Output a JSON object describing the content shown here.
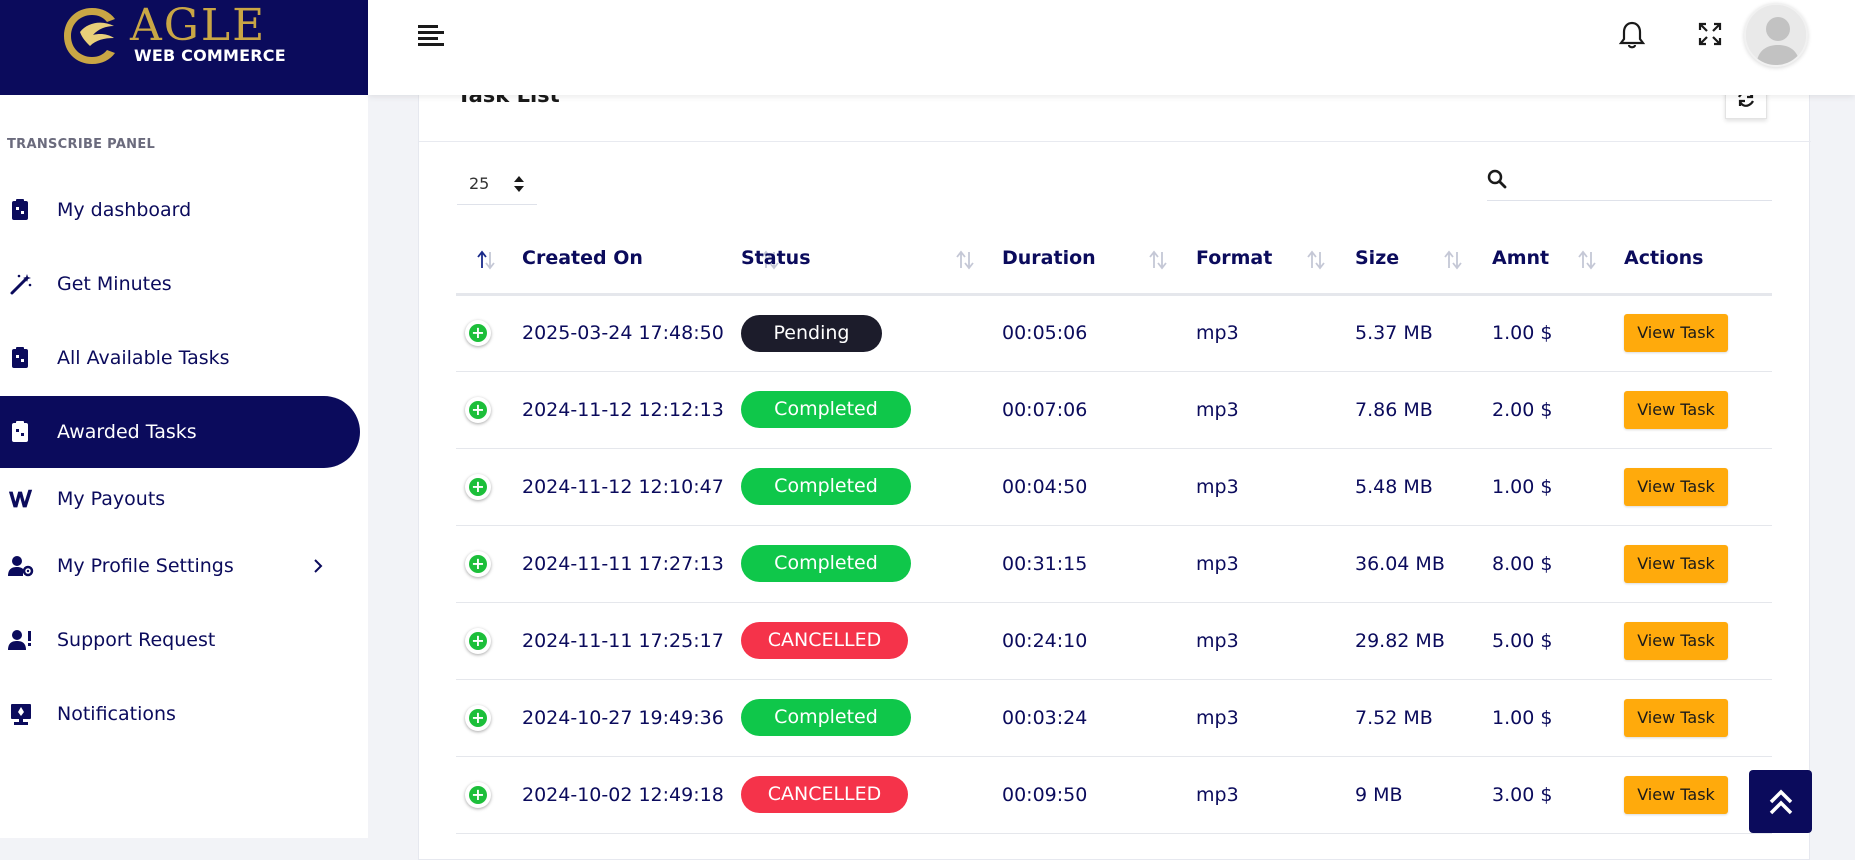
{
  "brand": {
    "logo_word": "AGLE",
    "logo_subtitle": "WEB COMMERCE",
    "primary_color": "#0b0b5c",
    "accent_gold": "#c9a645"
  },
  "sidebar": {
    "panel_label": "TRANSCRIBE PANEL",
    "items": [
      {
        "label": "My dashboard",
        "icon": "dashboard-icon",
        "active": false
      },
      {
        "label": "Get Minutes",
        "icon": "magic-wand-icon",
        "active": false
      },
      {
        "label": "All Available Tasks",
        "icon": "tasks-icon",
        "active": false
      },
      {
        "label": "Awarded Tasks",
        "icon": "awarded-icon",
        "active": true
      },
      {
        "label": "My Payouts",
        "icon": "payouts-icon",
        "active": false
      },
      {
        "label": "My Profile Settings",
        "icon": "user-settings-icon",
        "active": false,
        "has_submenu": true
      },
      {
        "label": "Support Request",
        "icon": "support-icon",
        "active": false
      },
      {
        "label": "Notifications",
        "icon": "notifications-icon",
        "active": false
      }
    ]
  },
  "topbar": {
    "icons": [
      "menu-icon",
      "bell-icon",
      "fullscreen-icon",
      "avatar"
    ]
  },
  "card": {
    "title": "Task List",
    "page_size": "25",
    "search_placeholder": ""
  },
  "table": {
    "columns": [
      "",
      "Created On",
      "Status",
      "Duration",
      "Format",
      "Size",
      "Amnt",
      "Actions"
    ],
    "rows": [
      {
        "created_on": "2025-03-24 17:48:50",
        "status": "Pending",
        "status_type": "pending",
        "duration": "00:05:06",
        "format": "mp3",
        "size": "5.37 MB",
        "amount": "1.00 $",
        "action": "View Task"
      },
      {
        "created_on": "2024-11-12 12:12:13",
        "status": "Completed",
        "status_type": "completed",
        "duration": "00:07:06",
        "format": "mp3",
        "size": "7.86 MB",
        "amount": "2.00 $",
        "action": "View Task"
      },
      {
        "created_on": "2024-11-12 12:10:47",
        "status": "Completed",
        "status_type": "completed",
        "duration": "00:04:50",
        "format": "mp3",
        "size": "5.48 MB",
        "amount": "1.00 $",
        "action": "View Task"
      },
      {
        "created_on": "2024-11-11 17:27:13",
        "status": "Completed",
        "status_type": "completed",
        "duration": "00:31:15",
        "format": "mp3",
        "size": "36.04 MB",
        "amount": "8.00 $",
        "action": "View Task"
      },
      {
        "created_on": "2024-11-11 17:25:17",
        "status": "CANCELLED",
        "status_type": "cancelled",
        "duration": "00:24:10",
        "format": "mp3",
        "size": "29.82 MB",
        "amount": "5.00 $",
        "action": "View Task"
      },
      {
        "created_on": "2024-10-27 19:49:36",
        "status": "Completed",
        "status_type": "completed",
        "duration": "00:03:24",
        "format": "mp3",
        "size": "7.52 MB",
        "amount": "1.00 $",
        "action": "View Task"
      },
      {
        "created_on": "2024-10-02 12:49:18",
        "status": "CANCELLED",
        "status_type": "cancelled",
        "duration": "00:09:50",
        "format": "mp3",
        "size": "9 MB",
        "amount": "3.00 $",
        "action": "View Task"
      }
    ]
  },
  "status_colors": {
    "pending": "#1c1c2b",
    "completed": "#0fc74a",
    "cancelled": "#f5334a",
    "action_button": "#ffaa0c"
  }
}
